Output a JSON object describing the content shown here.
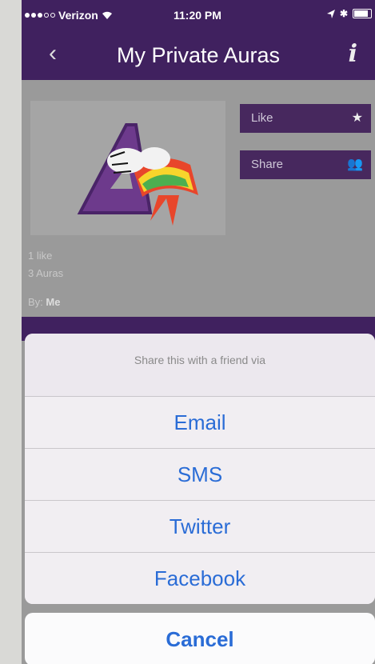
{
  "status_bar": {
    "carrier": "Verizon",
    "time": "11:20 PM",
    "icons": [
      "signal-dots-icon",
      "wifi-icon",
      "location-icon",
      "bluetooth-icon",
      "battery-icon"
    ]
  },
  "nav": {
    "back_icon": "‹",
    "title": "My Private Auras",
    "info_icon": "i"
  },
  "content": {
    "like_label": "Like",
    "share_label": "Share",
    "likes_text": "1 like",
    "auras_text": "3 Auras",
    "by_label": "By:",
    "by_name": "Me"
  },
  "share_sheet": {
    "title": "Share this with a friend via",
    "options": [
      "Email",
      "SMS",
      "Twitter",
      "Facebook"
    ],
    "cancel": "Cancel"
  },
  "colors": {
    "header_purple": "#40215f",
    "button_purple": "#47285e",
    "ios_blue": "#2a6cd6"
  }
}
